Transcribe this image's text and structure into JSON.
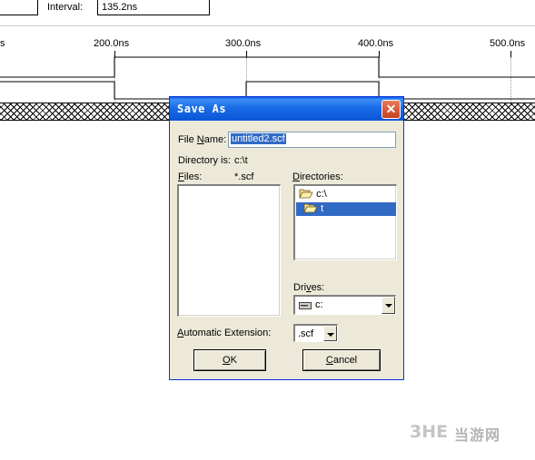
{
  "editor": {
    "interval_label": "Interval:",
    "interval_value": "135.2ns",
    "ticks": [
      "s",
      "200.0ns",
      "300.0ns",
      "400.0ns",
      "500.0ns"
    ]
  },
  "dialog": {
    "title": "Save As",
    "close_glyph": "✕",
    "file_name_label_pre": "File ",
    "file_name_label_key": "N",
    "file_name_label_post": "ame:",
    "file_name_value": "untitled2.scf",
    "directory_is_label": "Directory is:",
    "directory_is_value": "c:\\t",
    "files_label_key": "F",
    "files_label_post": "iles:",
    "files_filter": "*.scf",
    "directories_label_key": "D",
    "directories_label_post": "irectories:",
    "directories": [
      {
        "name": "c:\\",
        "icon": "open-folder-icon",
        "selected": false
      },
      {
        "name": "t",
        "icon": "open-folder-icon",
        "selected": true
      }
    ],
    "drives_label_pre": "Dri",
    "drives_label_key": "v",
    "drives_label_post": "es:",
    "drive_value": "c:",
    "auto_ext_label_key": "A",
    "auto_ext_label_post": "utomatic Extension:",
    "auto_ext_value": ".scf",
    "ok_label_key": "O",
    "ok_label_post": "K",
    "cancel_label_pre": "",
    "cancel_label_key": "C",
    "cancel_label_post": "ancel"
  },
  "watermark": {
    "logo": "3HE",
    "text": "当游网"
  },
  "colors": {
    "title_blue": "#0a5fe4",
    "selection": "#316ac5",
    "dialog_face": "#ece9d8",
    "close_red": "#c5401f"
  }
}
